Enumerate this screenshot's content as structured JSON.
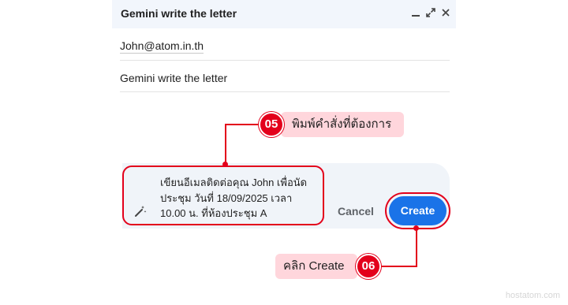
{
  "compose": {
    "title": "Gemini write the letter",
    "to": "John@atom.in.th",
    "subject": "Gemini write the letter",
    "window_controls": [
      "minimize-icon",
      "expand-icon",
      "close-icon"
    ]
  },
  "gemini": {
    "prompt_line1": "เขียนอีเมลติดต่อคุณ John เพื่อนัด",
    "prompt_line2": "ประชุม วันที่ 18/09/2025 เวลา",
    "prompt_line3": "10.00 น. ที่ห้องประชุม A",
    "cancel_label": "Cancel",
    "create_label": "Create"
  },
  "annotations": {
    "step5_number": "05",
    "step5_text": "พิมพ์คำสั่งที่ต้องการ",
    "step6_number": "06",
    "step6_text": "คลิก Create",
    "accent": "#e3001b",
    "callout_bg": "#ffd6dc"
  },
  "watermark": "hostatom.com"
}
